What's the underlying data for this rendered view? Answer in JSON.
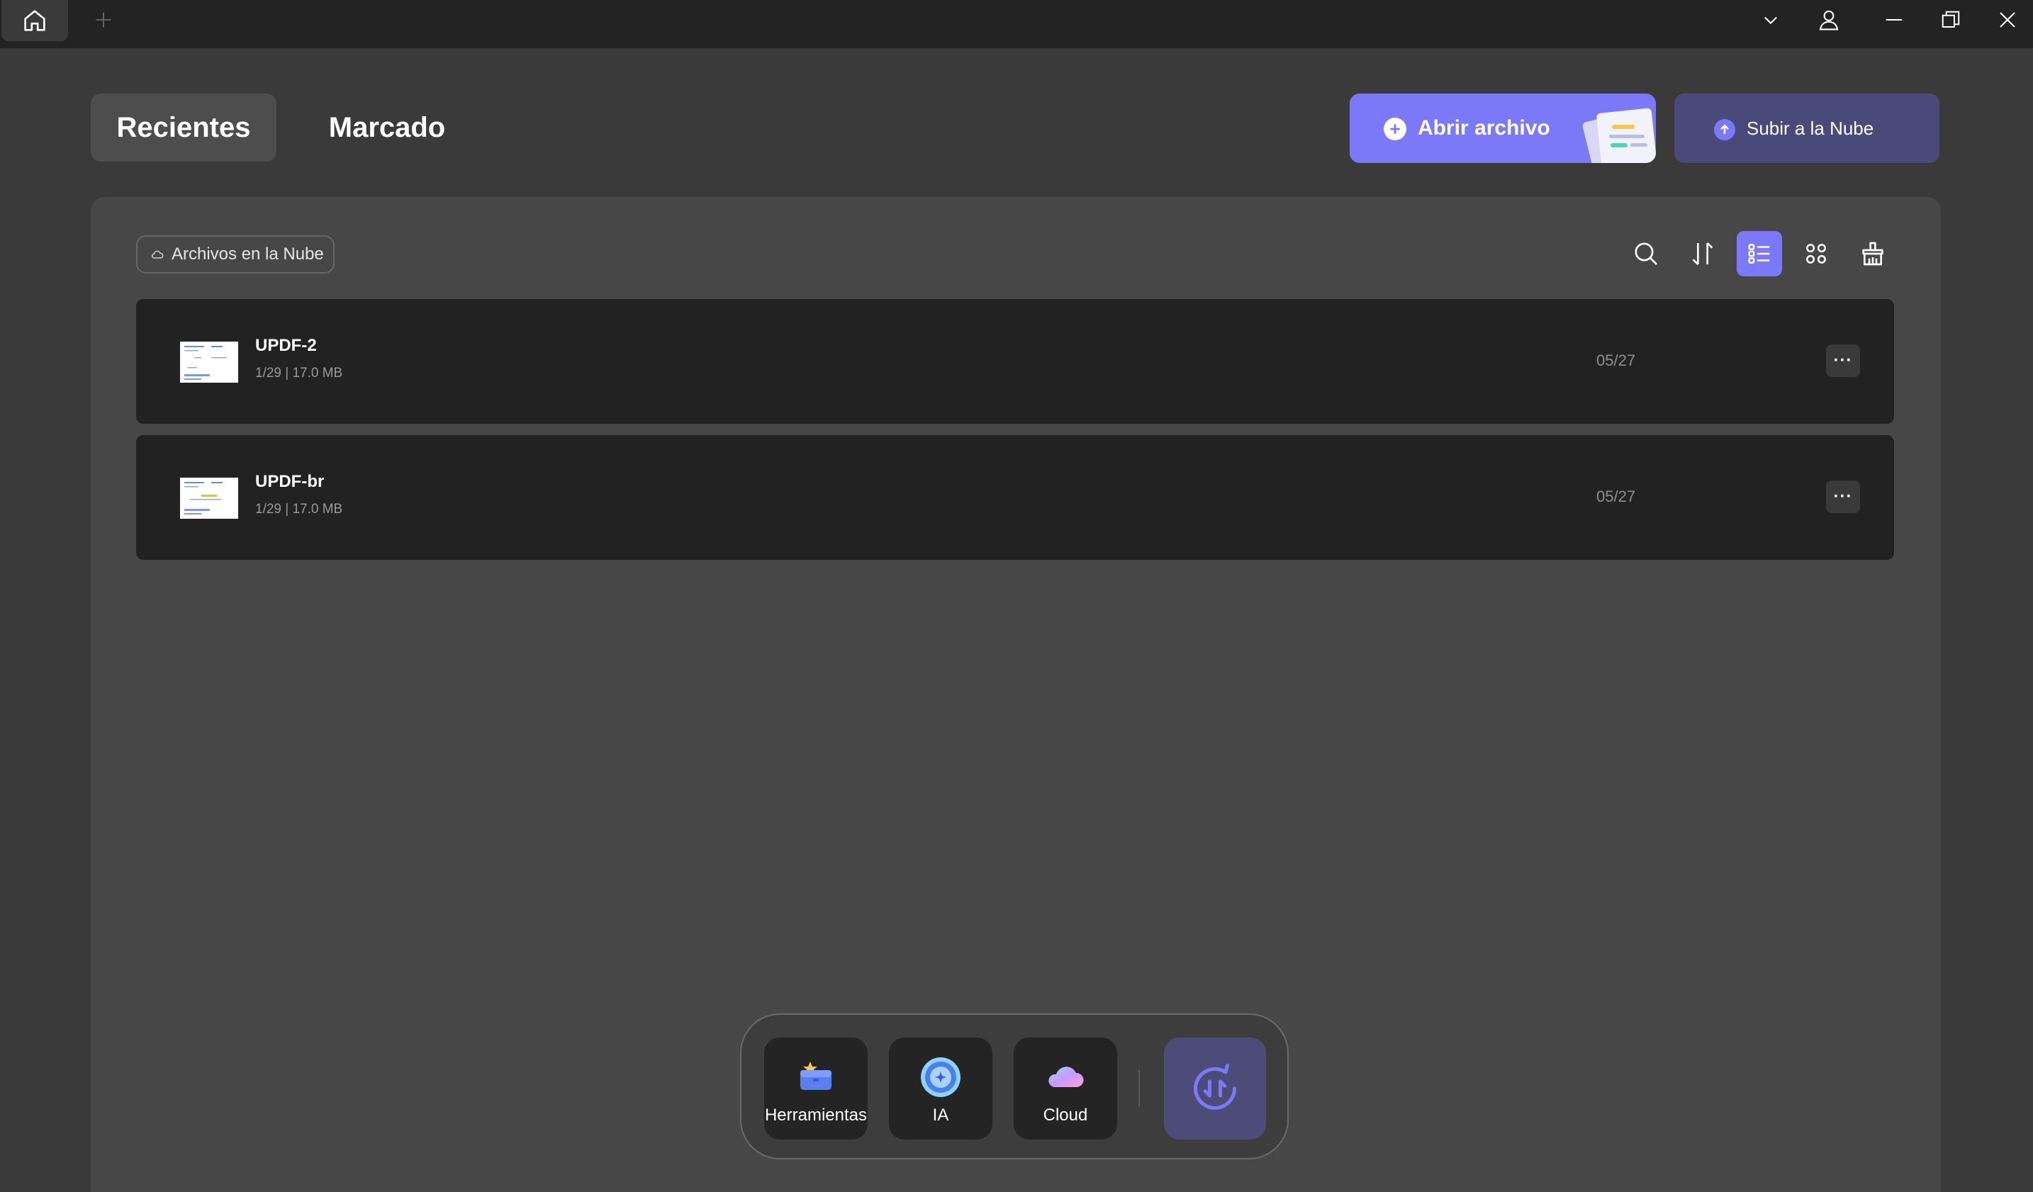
{
  "titlebar": {
    "icons": [
      "home-icon",
      "plus-icon",
      "chevron-down-icon",
      "user-icon",
      "minimize-icon",
      "restore-icon",
      "close-icon"
    ]
  },
  "tabs": [
    {
      "label": "Recientes",
      "active": true
    },
    {
      "label": "Marcado",
      "active": false
    }
  ],
  "actions": {
    "open_file": "Abrir archivo",
    "upload_cloud": "Subir a la Nube"
  },
  "panel": {
    "cloud_chip": "Archivos en la Nube",
    "toolbar_icons": [
      "search-icon",
      "sort-icon",
      "list-view-icon",
      "grid-view-icon",
      "clean-icon"
    ],
    "active_view": "list"
  },
  "files": [
    {
      "name": "UPDF-2",
      "meta": "1/29 | 17.0 MB",
      "date": "05/27",
      "more": "···"
    },
    {
      "name": "UPDF-br",
      "meta": "1/29 | 17.0 MB",
      "date": "05/27",
      "more": "···"
    }
  ],
  "dock": {
    "items": [
      {
        "label": "Herramientas",
        "icon": "toolbox-icon"
      },
      {
        "label": "IA",
        "icon": "ai-icon"
      },
      {
        "label": "Cloud",
        "icon": "cloud-icon"
      }
    ],
    "sync_icon": "sync-icon"
  },
  "colors": {
    "accent": "#7b79f7",
    "background": "#3a3a3a",
    "panel": "#474747",
    "row": "#222222",
    "titlebar": "#232323"
  }
}
